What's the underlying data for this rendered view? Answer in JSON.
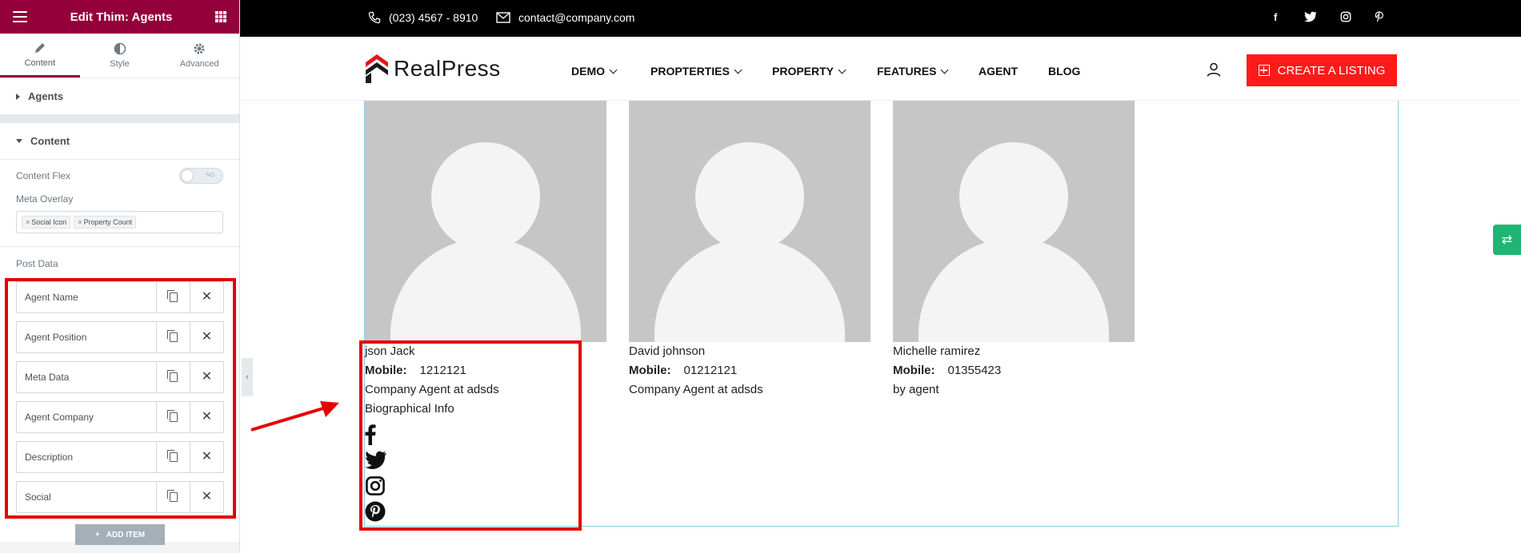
{
  "editor": {
    "title": "Edit Thim: Agents",
    "tabs": [
      {
        "label": "Content"
      },
      {
        "label": "Style"
      },
      {
        "label": "Advanced"
      }
    ],
    "sections": {
      "agents": "Agents",
      "content": "Content"
    },
    "controls": {
      "content_flex_label": "Content Flex",
      "toggle_text": "NO",
      "meta_overlay_label": "Meta Overlay",
      "meta_overlay_chips": [
        "Social Icon",
        "Property Count"
      ],
      "post_data_label": "Post Data"
    },
    "post_data_items": [
      {
        "label": "Agent Name"
      },
      {
        "label": "Agent Position"
      },
      {
        "label": "Meta Data"
      },
      {
        "label": "Agent Company"
      },
      {
        "label": "Description"
      },
      {
        "label": "Social"
      }
    ],
    "add_item_label": "ADD ITEM"
  },
  "topbar": {
    "phone": "(023) 4567 - 8910",
    "email": "contact@company.com",
    "social": [
      "f",
      "twitter",
      "instagram",
      "pinterest"
    ]
  },
  "nav": {
    "brand": "RealPress",
    "items": [
      {
        "label": "DEMO",
        "dropdown": true
      },
      {
        "label": "PROPTERTIES",
        "dropdown": true
      },
      {
        "label": "PROPERTY",
        "dropdown": true
      },
      {
        "label": "FEATURES",
        "dropdown": true
      },
      {
        "label": "AGENT",
        "dropdown": false
      },
      {
        "label": "BLOG",
        "dropdown": false
      }
    ],
    "cta": "CREATE A LISTING"
  },
  "agents": [
    {
      "name": "json Jack",
      "mobile_label": "Mobile:",
      "mobile": "1212121",
      "company": "Company Agent at adsds",
      "bio": "Biographical Info"
    },
    {
      "name": "David johnson",
      "mobile_label": "Mobile:",
      "mobile": "01212121",
      "company": "Company Agent at adsds"
    },
    {
      "name": "Michelle ramirez",
      "mobile_label": "Mobile:",
      "mobile": "01355423",
      "company": "by agent"
    }
  ],
  "colors": {
    "editor_header": "#93003a",
    "cta": "#ff1a1a",
    "highlight": "#e60000",
    "float_button": "#20b473"
  }
}
